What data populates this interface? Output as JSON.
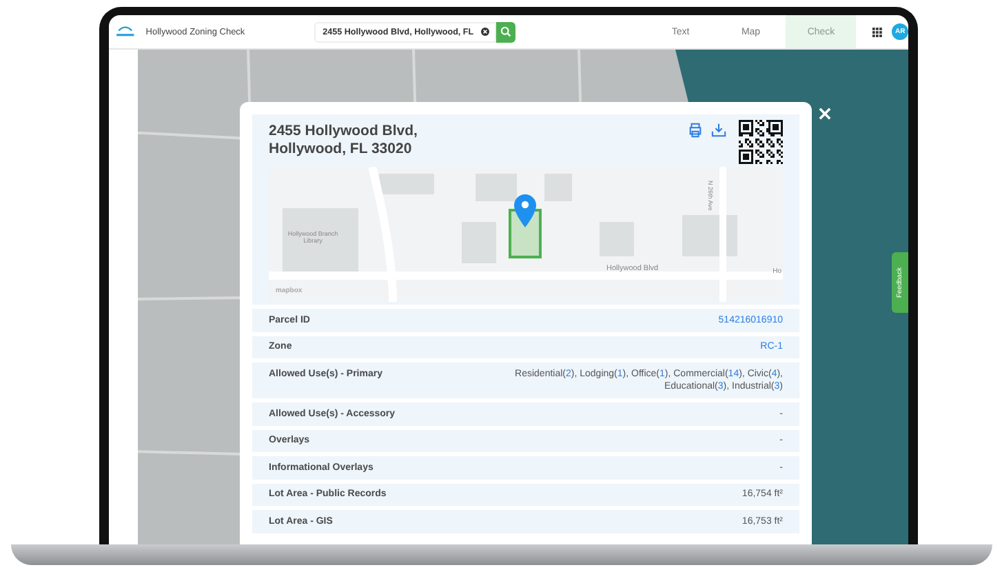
{
  "app": {
    "title": "Hollywood Zoning Check",
    "search": {
      "value": "2455 Hollywood Blvd, Hollywood, FL"
    },
    "tabs": [
      {
        "label": "Text",
        "selected": false
      },
      {
        "label": "Map",
        "selected": false
      },
      {
        "label": "Check",
        "selected": true
      }
    ],
    "avatar": "AR"
  },
  "parcel": {
    "address": [
      "2455 Hollywood Blvd,",
      "Hollywood, FL 33020"
    ],
    "map_labels": [
      {
        "kind": "poi",
        "text": "Hollywood Branch Library"
      },
      {
        "kind": "street",
        "text": "Hollywood Blvd"
      },
      {
        "kind": "vstreet",
        "text": "N 26th Ave"
      },
      {
        "kind": "edge",
        "text": "Ho"
      },
      {
        "kind": "credit",
        "text": "mapbox"
      }
    ],
    "rows": [
      {
        "label": "Parcel ID",
        "kind": "link",
        "value": "514216016910"
      },
      {
        "label": "Zone",
        "kind": "link",
        "value": "RC-1"
      },
      {
        "label": "Allowed Use(s) - Primary",
        "kind": "segments",
        "segments": [
          {
            "kind": "text",
            "text": "Residential("
          },
          {
            "kind": "count",
            "text": "2"
          },
          {
            "kind": "text",
            "text": "), Lodging("
          },
          {
            "kind": "count",
            "text": "1"
          },
          {
            "kind": "text",
            "text": "), Office("
          },
          {
            "kind": "count",
            "text": "1"
          },
          {
            "kind": "text",
            "text": "), Commercial("
          },
          {
            "kind": "count",
            "text": "14"
          },
          {
            "kind": "text",
            "text": "), Civic("
          },
          {
            "kind": "count",
            "text": "4"
          },
          {
            "kind": "text",
            "text": "), Educational("
          },
          {
            "kind": "count",
            "text": "3"
          },
          {
            "kind": "text",
            "text": "), Industrial("
          },
          {
            "kind": "count",
            "text": "3"
          },
          {
            "kind": "text",
            "text": ")"
          }
        ]
      },
      {
        "label": "Allowed Use(s) - Accessory",
        "kind": "text",
        "value": "-"
      },
      {
        "label": "Overlays",
        "kind": "text",
        "value": "-"
      },
      {
        "label": "Informational Overlays",
        "kind": "text",
        "value": "-"
      },
      {
        "label": "Lot Area - Public Records",
        "kind": "text",
        "value": "16,754 ft²"
      },
      {
        "label": "Lot Area - GIS",
        "kind": "text",
        "value": "16,753 ft²"
      }
    ]
  },
  "feedback": "Feedback"
}
